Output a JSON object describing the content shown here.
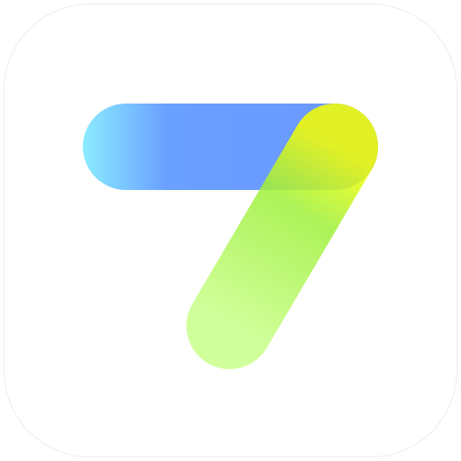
{
  "icon": {
    "logo_name": "seven-shaped-app-logo",
    "colors": {
      "tile_background": "#ffffff",
      "tile_border": "#ececec",
      "bar_start": "#7ee8ff",
      "bar_mid": "#5a96ff",
      "bar_end": "#5b8cff",
      "stroke_top": "#f7ff00",
      "stroke_mid": "#9ef03a",
      "stroke_bottom": "#c9ff8a"
    }
  }
}
